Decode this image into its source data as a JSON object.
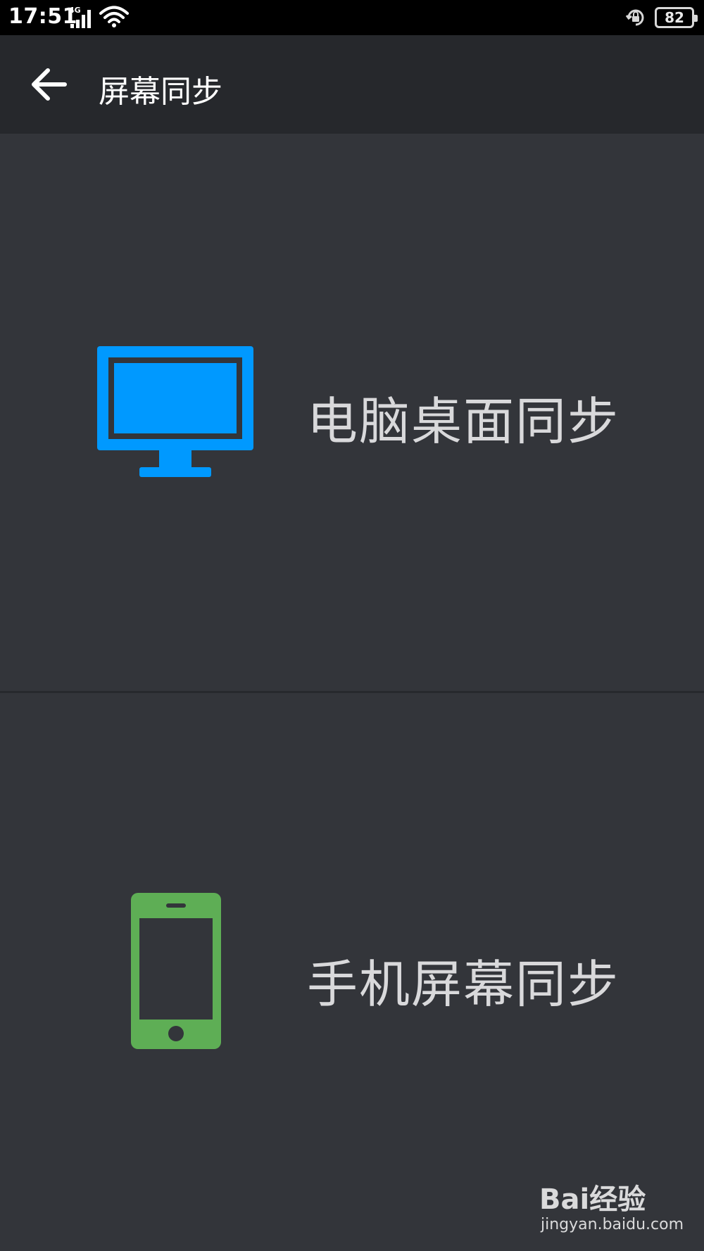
{
  "status_bar": {
    "time": "17:51",
    "network_type": "4G",
    "battery_level": "82",
    "icons": [
      "signal-icon",
      "wifi-icon",
      "rotation-lock-icon",
      "battery-icon"
    ]
  },
  "app_bar": {
    "title": "屏幕同步",
    "back_icon": "arrow-left-icon"
  },
  "options": [
    {
      "label": "电脑桌面同步",
      "icon": "monitor-icon",
      "icon_color": "#0099ff"
    },
    {
      "label": "手机屏幕同步",
      "icon": "smartphone-icon",
      "icon_color": "#5eae55"
    }
  ],
  "colors": {
    "background": "#33353a",
    "app_bar": "#26282c",
    "status_bar": "#000000",
    "label_text": "#d9d9db"
  },
  "watermark": {
    "brand": "Bai经验",
    "url": "jingyan.baidu.com"
  }
}
